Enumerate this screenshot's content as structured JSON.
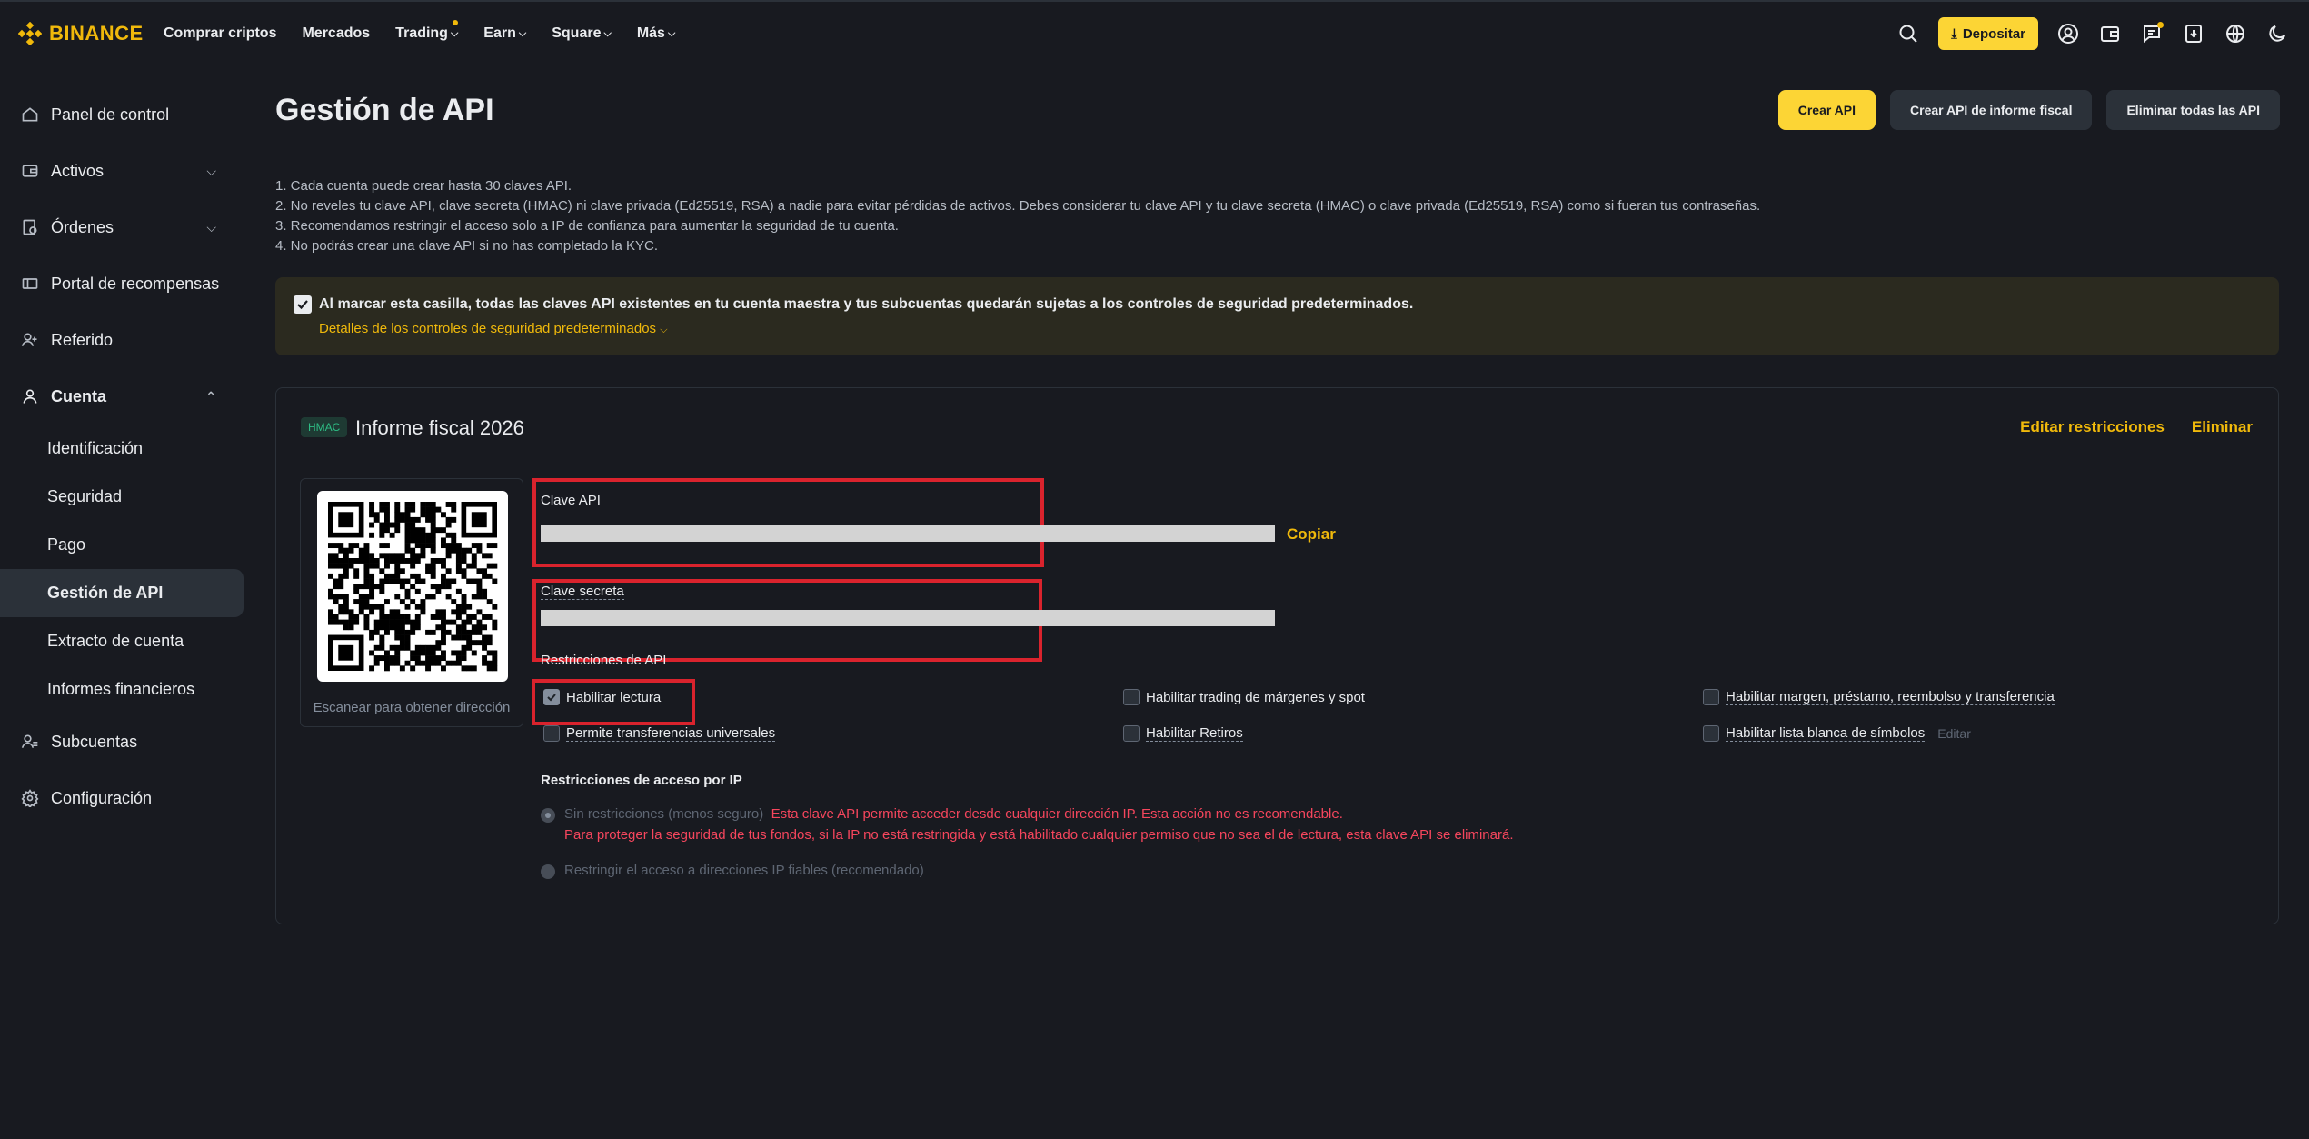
{
  "brand": {
    "name": "BINANCE",
    "color": "#f0b90b"
  },
  "nav": [
    {
      "label": "Comprar criptos",
      "chevron": false,
      "dot": false
    },
    {
      "label": "Mercados",
      "chevron": false,
      "dot": false
    },
    {
      "label": "Trading",
      "chevron": true,
      "dot": true
    },
    {
      "label": "Earn",
      "chevron": true,
      "dot": false
    },
    {
      "label": "Square",
      "chevron": true,
      "dot": false
    },
    {
      "label": "Más",
      "chevron": true,
      "dot": false
    }
  ],
  "header": {
    "deposit_label": "Depositar"
  },
  "sidebar": {
    "items": [
      {
        "label": "Panel de control"
      },
      {
        "label": "Activos"
      },
      {
        "label": "Órdenes"
      },
      {
        "label": "Portal de recompensas"
      },
      {
        "label": "Referido"
      },
      {
        "label": "Cuenta"
      }
    ],
    "account_sub": [
      {
        "label": "Identificación"
      },
      {
        "label": "Seguridad"
      },
      {
        "label": "Pago"
      },
      {
        "label": "Gestión de API"
      },
      {
        "label": "Extracto de cuenta"
      },
      {
        "label": "Informes financieros"
      }
    ],
    "bottom": [
      {
        "label": "Subcuentas"
      },
      {
        "label": "Configuración"
      }
    ]
  },
  "page": {
    "title": "Gestión de API",
    "create_api": "Crear API",
    "create_tax_api": "Crear API de informe fiscal",
    "delete_all": "Eliminar todas las API"
  },
  "notes": [
    "1. Cada cuenta puede crear hasta 30 claves API.",
    "2. No reveles tu clave API, clave secreta (HMAC) ni clave privada (Ed25519, RSA) a nadie para evitar pérdidas de activos. Debes considerar tu clave API y tu clave secreta (HMAC) o clave privada (Ed25519, RSA) como si fueran tus contraseñas.",
    "3. Recomendamos restringir el acceso solo a IP de confianza para aumentar la seguridad de tu cuenta.",
    "4. No podrás crear una clave API si no has completado la KYC."
  ],
  "banner": {
    "text": "Al marcar esta casilla, todas las claves API existentes en tu cuenta maestra y tus subcuentas quedarán sujetas a los controles de seguridad predeterminados.",
    "link": "Detalles de los controles de seguridad predeterminados"
  },
  "api_card": {
    "badge": "HMAC",
    "title": "Informe fiscal 2026",
    "edit": "Editar restricciones",
    "delete": "Eliminar",
    "qr_caption": "Escanear para obtener dirección",
    "api_key_label": "Clave API",
    "copy": "Copiar",
    "secret_label": "Clave secreta",
    "restrictions_label": "Restricciones de API",
    "permissions": [
      {
        "label": "Habilitar lectura",
        "checked": true
      },
      {
        "label": "Habilitar trading de márgenes y spot",
        "checked": false
      },
      {
        "label": "Habilitar margen, préstamo, reembolso y transferencia",
        "checked": false
      },
      {
        "label": "Permite transferencias universales",
        "checked": false
      },
      {
        "label": "Habilitar Retiros",
        "checked": false
      },
      {
        "label": "Habilitar lista blanca de símbolos",
        "checked": false
      }
    ],
    "edit_small": "Editar",
    "ip_label": "Restricciones de acceso por IP",
    "ip_unrestricted": "Sin restricciones (menos seguro)",
    "ip_warning_1": "Esta clave API permite acceder desde cualquier dirección IP. Esta acción no es recomendable.",
    "ip_warning_2": "Para proteger la seguridad de tus fondos, si la IP no está restringida y está habilitado cualquier permiso que no sea el de lectura, esta clave API se eliminará.",
    "ip_restricted": "Restringir el acceso a direcciones IP fiables (recomendado)"
  },
  "colors": {
    "accent": "#fcd535",
    "danger": "#f6465d",
    "highlight_box": "#d9232d"
  }
}
